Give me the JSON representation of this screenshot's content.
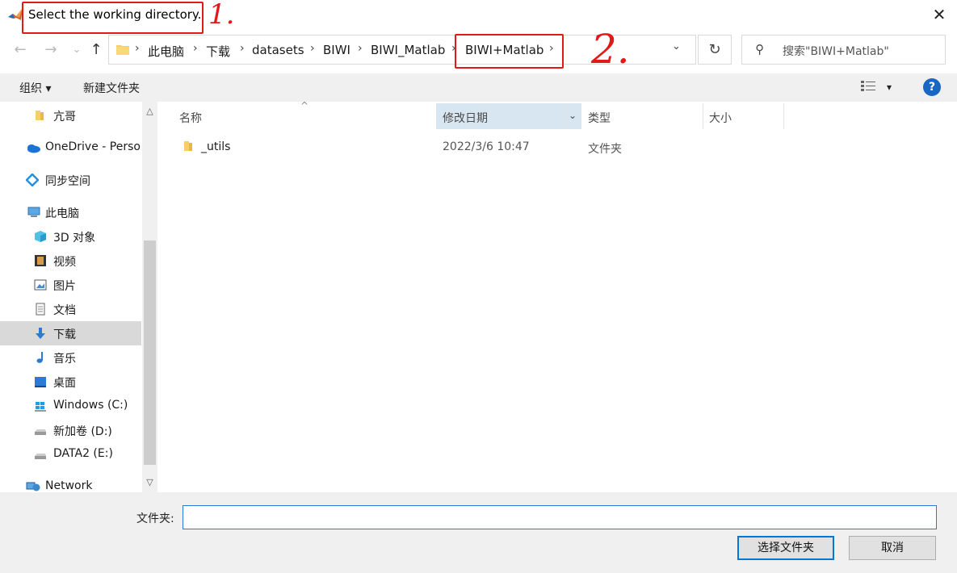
{
  "window": {
    "title": "Select the working directory.",
    "close_glyph": "✕",
    "app_icon": "matlab-icon"
  },
  "nav_buttons": {
    "back": "←",
    "forward": "→",
    "recent": "⌄",
    "up": "↑"
  },
  "address": {
    "crumbs": [
      "此电脑",
      "下载",
      "datasets",
      "BIWI",
      "BIWI_Matlab",
      "BIWI+Matlab"
    ],
    "separator": "›",
    "dropdown": "⌄",
    "refresh": "↻"
  },
  "search": {
    "placeholder": "搜索\"BIWI+Matlab\"",
    "icon": "⚲"
  },
  "toolbar": {
    "organize": "组织 ▾",
    "new_folder": "新建文件夹",
    "view_dropdown": "▾",
    "help": "?"
  },
  "nav_pane": {
    "items": [
      {
        "label": "亢哥",
        "icon": "folder-icon"
      },
      {
        "label": "OneDrive - Personal",
        "icon": "onedrive-icon"
      },
      {
        "label": "同步空间",
        "icon": "sync-space-icon"
      },
      {
        "label": "此电脑",
        "icon": "this-pc-icon"
      },
      {
        "label": "3D 对象",
        "icon": "3d-objects-icon"
      },
      {
        "label": "视频",
        "icon": "video-icon"
      },
      {
        "label": "图片",
        "icon": "pictures-icon"
      },
      {
        "label": "文档",
        "icon": "documents-icon"
      },
      {
        "label": "下载",
        "icon": "download-icon"
      },
      {
        "label": "音乐",
        "icon": "music-icon"
      },
      {
        "label": "桌面",
        "icon": "desktop-icon"
      },
      {
        "label": "Windows (C:)",
        "icon": "windows-drive-icon"
      },
      {
        "label": "新加卷 (D:)",
        "icon": "drive-icon"
      },
      {
        "label": "DATA2 (E:)",
        "icon": "drive-icon"
      },
      {
        "label": "Network",
        "icon": "network-icon"
      }
    ],
    "selected": "下载"
  },
  "columns": {
    "name": "名称",
    "date": "修改日期",
    "type": "类型",
    "size": "大小",
    "sort_glyph": "^",
    "date_dropdown": "⌄"
  },
  "files": [
    {
      "name": "_utils",
      "date": "2022/3/6 10:47",
      "type": "文件夹",
      "size": ""
    }
  ],
  "bottom": {
    "folder_label": "文件夹:",
    "folder_value": "",
    "select_button": "选择文件夹",
    "cancel_button": "取消"
  },
  "annotations": {
    "note1": "1.",
    "note2": "2.",
    "color": "#e11919"
  },
  "colors": {
    "accent": "#0078d7",
    "selected_nav": "#d9d9d9",
    "sorted_col": "#d8e6f2",
    "help": "#1a66c4"
  }
}
